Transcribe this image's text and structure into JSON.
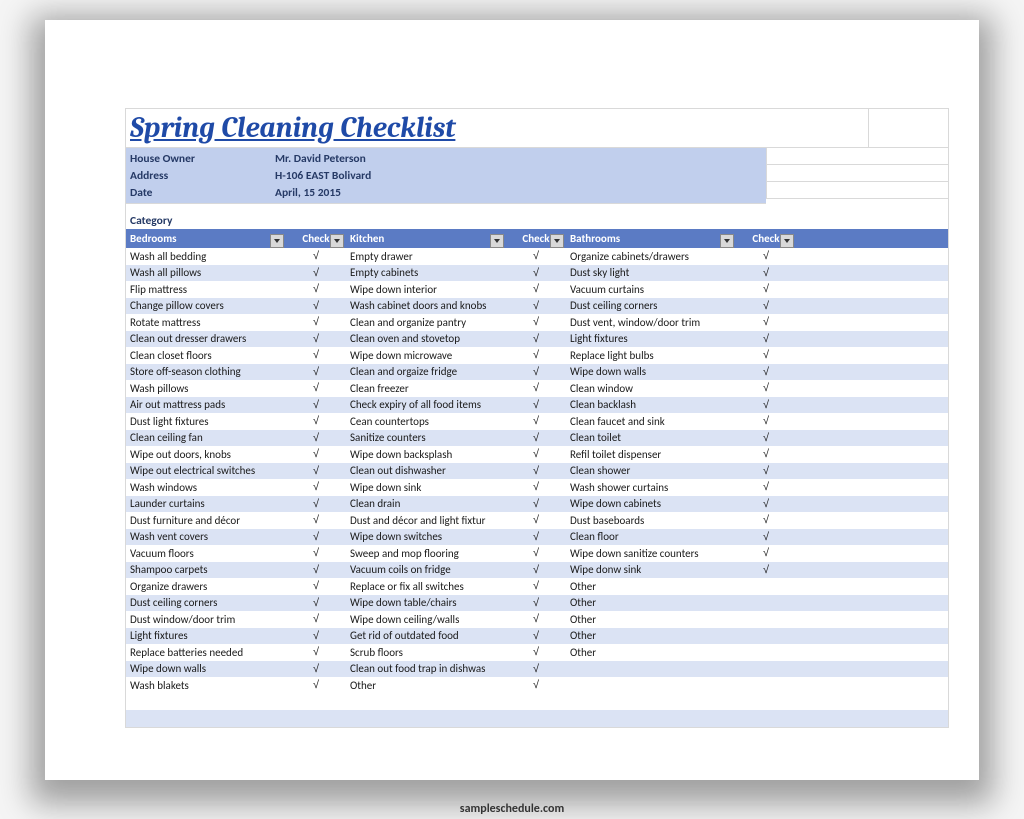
{
  "title": "Spring Cleaning Checklist",
  "info": {
    "owner_label": "House Owner",
    "owner_value": "Mr. David Peterson",
    "address_label": "Address",
    "address_value": "H-106 EAST Bolivard",
    "date_label": "Date",
    "date_value": "April, 15 2015"
  },
  "category_label": "Category",
  "headers": {
    "bedrooms": "Bedrooms",
    "check": "Check",
    "kitchen": "Kitchen",
    "bathrooms": "Bathrooms"
  },
  "check_mark": "√",
  "rows": [
    {
      "b": "Wash all bedding",
      "bc": true,
      "k": "Empty drawer",
      "kc": true,
      "t": "Organize cabinets/drawers",
      "tc": true
    },
    {
      "b": "Wash all pillows",
      "bc": true,
      "k": "Empty cabinets",
      "kc": true,
      "t": "Dust sky light",
      "tc": true
    },
    {
      "b": "Flip mattress",
      "bc": true,
      "k": "Wipe down interior",
      "kc": true,
      "t": "Vacuum curtains",
      "tc": true
    },
    {
      "b": "Change pillow covers",
      "bc": true,
      "k": "Wash cabinet doors and knobs",
      "kc": true,
      "t": "Dust ceiling corners",
      "tc": true
    },
    {
      "b": "Rotate mattress",
      "bc": true,
      "k": "Clean and organize pantry",
      "kc": true,
      "t": "Dust vent, window/door trim",
      "tc": true
    },
    {
      "b": "Clean out dresser drawers",
      "bc": true,
      "k": "Clean oven and stovetop",
      "kc": true,
      "t": "Light fixtures",
      "tc": true
    },
    {
      "b": "Clean closet floors",
      "bc": true,
      "k": "Wipe down microwave",
      "kc": true,
      "t": "Replace light bulbs",
      "tc": true
    },
    {
      "b": "Store off-season clothing",
      "bc": true,
      "k": "Clean and orgaize fridge",
      "kc": true,
      "t": "Wipe down walls",
      "tc": true
    },
    {
      "b": "Wash pillows",
      "bc": true,
      "k": "Clean freezer",
      "kc": true,
      "t": "Clean window",
      "tc": true
    },
    {
      "b": "Air out mattress pads",
      "bc": true,
      "k": "Check expiry of all food items",
      "kc": true,
      "t": "Clean backlash",
      "tc": true
    },
    {
      "b": "Dust light fixtures",
      "bc": true,
      "k": "Cean countertops",
      "kc": true,
      "t": "Clean faucet and sink",
      "tc": true
    },
    {
      "b": "Clean ceiling fan",
      "bc": true,
      "k": "Sanitize counters",
      "kc": true,
      "t": "Clean toilet",
      "tc": true
    },
    {
      "b": "Wipe out doors, knobs",
      "bc": true,
      "k": "Wipe down backsplash",
      "kc": true,
      "t": "Refil toilet dispenser",
      "tc": true
    },
    {
      "b": "Wipe out electrical switches",
      "bc": true,
      "k": "Clean out dishwasher",
      "kc": true,
      "t": "Clean shower",
      "tc": true
    },
    {
      "b": "Wash windows",
      "bc": true,
      "k": "Wipe down sink",
      "kc": true,
      "t": "Wash shower curtains",
      "tc": true
    },
    {
      "b": "Launder curtains",
      "bc": true,
      "k": "Clean drain",
      "kc": true,
      "t": "Wipe down cabinets",
      "tc": true
    },
    {
      "b": "Dust furniture and décor",
      "bc": true,
      "k": "Dust and décor and light fixtur",
      "kc": true,
      "t": "Dust baseboards",
      "tc": true
    },
    {
      "b": "Wash vent covers",
      "bc": true,
      "k": "Wipe down switches",
      "kc": true,
      "t": "Clean floor",
      "tc": true
    },
    {
      "b": "Vacuum floors",
      "bc": true,
      "k": "Sweep and mop flooring",
      "kc": true,
      "t": "Wipe down sanitize counters",
      "tc": true
    },
    {
      "b": "Shampoo carpets",
      "bc": true,
      "k": "Vacuum coils on fridge",
      "kc": true,
      "t": "Wipe donw sink",
      "tc": true
    },
    {
      "b": "Organize drawers",
      "bc": true,
      "k": "Replace or fix all switches",
      "kc": true,
      "t": "Other",
      "tc": false
    },
    {
      "b": "Dust ceiling corners",
      "bc": true,
      "k": "Wipe down table/chairs",
      "kc": true,
      "t": "Other",
      "tc": false
    },
    {
      "b": "Dust window/door trim",
      "bc": true,
      "k": "Wipe down ceiling/walls",
      "kc": true,
      "t": "Other",
      "tc": false
    },
    {
      "b": "Light fixtures",
      "bc": true,
      "k": "Get rid of outdated  food",
      "kc": true,
      "t": "Other",
      "tc": false
    },
    {
      "b": "Replace batteries needed",
      "bc": true,
      "k": "Scrub floors",
      "kc": true,
      "t": "Other",
      "tc": false
    },
    {
      "b": "Wipe down walls",
      "bc": true,
      "k": "Clean out food trap in dishwas",
      "kc": true,
      "t": "",
      "tc": false
    },
    {
      "b": "Wash blakets",
      "bc": true,
      "k": "Other",
      "kc": true,
      "t": "",
      "tc": false
    }
  ],
  "footer": "sampleschedule.com"
}
